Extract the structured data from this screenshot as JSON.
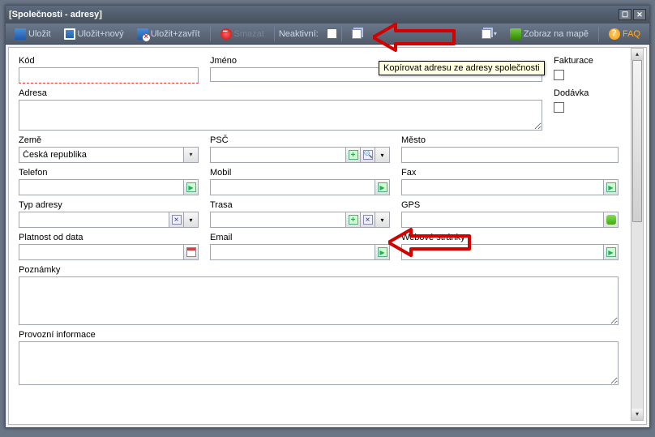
{
  "window": {
    "title": "[Společnosti - adresy]"
  },
  "toolbar": {
    "save": "Uložit",
    "save_new": "Uložit+nový",
    "save_close": "Uložit+zavřít",
    "delete": "Smazat",
    "inactive": "Neaktivní:",
    "show_on_map": "Zobraz na mapě",
    "faq": "FAQ"
  },
  "tooltip": "Kopírovat adresu ze adresy společnosti",
  "labels": {
    "code": "Kód",
    "name": "Jméno",
    "address": "Adresa",
    "invoice": "Fakturace",
    "delivery": "Dodávka",
    "country": "Země",
    "zip": "PSČ",
    "city": "Město",
    "phone": "Telefon",
    "mobile": "Mobil",
    "fax": "Fax",
    "addr_type": "Typ adresy",
    "route": "Trasa",
    "gps": "GPS",
    "valid_from": "Platnost od data",
    "email": "Email",
    "web": "Webové stránky",
    "notes": "Poznámky",
    "business_info": "Provozní informace"
  },
  "values": {
    "country": "Česká republika"
  }
}
